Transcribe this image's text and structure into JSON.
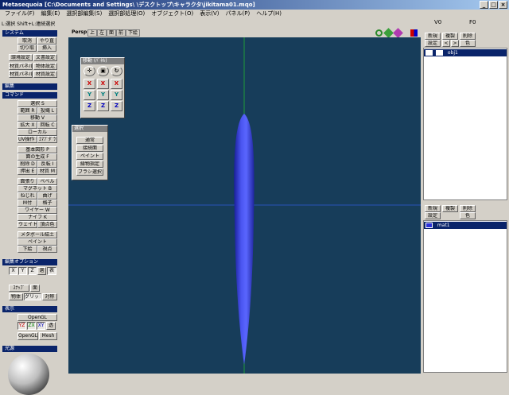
{
  "window": {
    "title": "Metasequoia [C:\\Documents and Settings\\        \\デスクトップ\\キャラクタ\\jikitama01.mqo]",
    "min": "_",
    "max": "□",
    "close": "×"
  },
  "menu": [
    "ファイル(F)",
    "編集(E)",
    "選択部編集(S)",
    "選択部処理(O)",
    "オブジェクト(O)",
    "表示(V)",
    "パネル(P)",
    "ヘルプ(H)"
  ],
  "status": {
    "hint": "L:選択 Shift+L:連続選択",
    "v_label": "V0",
    "f_label": "F0"
  },
  "left": {
    "system_title": "システム",
    "system_buttons": [
      "取消",
      "やり直",
      "切り取",
      "挿入"
    ],
    "system_buttons2": [
      "環境設定",
      "文書設定",
      "材質パネル",
      "物体設定",
      "材質パネル",
      "材質設定"
    ],
    "edit_title": "編集",
    "command_title": "コマンド",
    "commands": [
      "選択 S",
      "範囲 R",
      "投縄 L",
      "移動 V",
      "拡大 X",
      "回転 C",
      "ローカル",
      "UV操作 U",
      "ｴﾏﾌﾟﾀﾞﾗ",
      "基本図形 P",
      "面の生成 F",
      "削除 D",
      "反転 I",
      "押出 E",
      "材質 M",
      "面張り",
      "ベベル",
      "マグネット B",
      "ねじれ",
      "曲げ",
      "M付",
      "格子",
      "ワイヤー W",
      "ナイフ K",
      "ウェイト",
      "頂点色",
      "メタボール結土",
      "ペイント",
      "下絵",
      "視点"
    ],
    "edit_opts_title": "編集オプション",
    "opts": [
      "X",
      "Y",
      "Z",
      "選",
      "表",
      "ｽﾅｯﾌﾟ",
      "面",
      "物体",
      "グリッド",
      "対称"
    ],
    "view_title": "表示",
    "view_opts": [
      "OpenGL",
      "YZ",
      "ZX",
      "XY",
      "透",
      "OpenGL",
      "Mesh"
    ],
    "light_title": "光源"
  },
  "viewport": {
    "tabs": [
      "Persp",
      "上",
      "左",
      "面",
      "前",
      "下絵"
    ],
    "bg": "#173d5a",
    "mesh_color": "#3a45e0"
  },
  "move_panel": {
    "title": "移動 (ﾊﾟﾈﾙ)",
    "icons": [
      "move-icon",
      "scale-icon",
      "rotate-icon"
    ],
    "axes": [
      "X",
      "X",
      "X",
      "Y",
      "Y",
      "Y",
      "Z",
      "Z",
      "Z"
    ]
  },
  "select_panel": {
    "title": "選択",
    "items": [
      "通常",
      "接続面",
      "ペイント",
      "縁物指定",
      "ブラシ選択"
    ]
  },
  "objects": {
    "header": [
      "新規",
      "複製",
      "削除"
    ],
    "header2": [
      "設定",
      "<",
      ">",
      "色"
    ],
    "items": [
      {
        "name": "obj1"
      }
    ]
  },
  "materials": {
    "header": [
      "新規",
      "複製",
      "削除"
    ],
    "header2": [
      "設定",
      "色"
    ],
    "items": [
      {
        "name": "mat1"
      }
    ]
  }
}
